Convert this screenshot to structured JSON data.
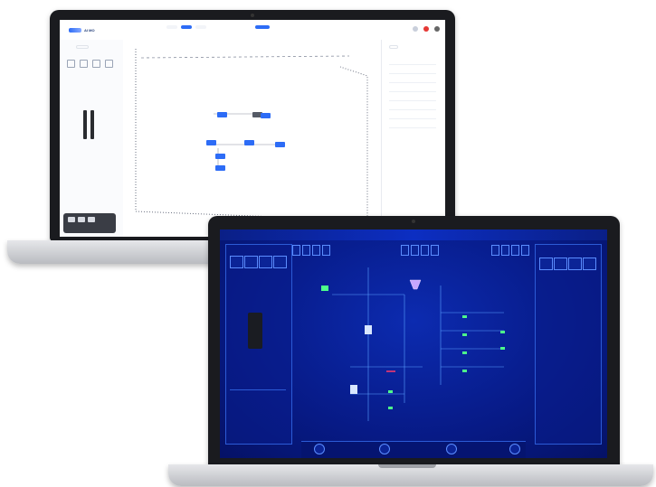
{
  "light_app": {
    "logo": "AI MO",
    "app_name": "",
    "menu": [
      "",
      "",
      ""
    ],
    "tabs": [
      "",
      "",
      "",
      ""
    ],
    "left_panel_title": "",
    "right_panel_title": ""
  },
  "dark_app": {
    "title": "",
    "top_left": "",
    "top_right": "",
    "left_panel_title": "",
    "right_panel_title": ""
  },
  "colors": {
    "light_accent": "#2d6cf6",
    "dark_bg": "#071a86",
    "dark_accent": "#5b8dff",
    "dark_green": "#4dff8a"
  }
}
